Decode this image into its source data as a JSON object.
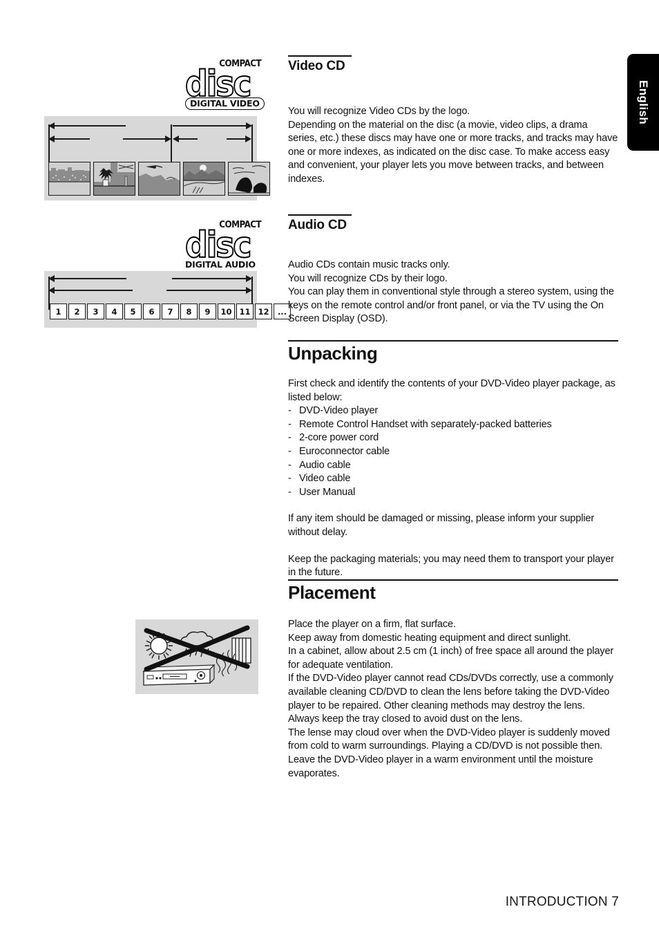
{
  "language_tab": {
    "label": "English"
  },
  "logos": {
    "video": {
      "word": "COMPACT",
      "disc": "disc",
      "sub": "DIGITAL VIDEO"
    },
    "audio": {
      "word": "COMPACT",
      "disc": "disc",
      "sub": "DIGITAL AUDIO"
    }
  },
  "diagrams": {
    "video_cd": {
      "caption": "",
      "thumbnail_count": 5,
      "thumbnails": [
        "city-street-scene",
        "indoor-plant-room-scene",
        "aircraft-over-landscape-scene",
        "sunset-hills-scene",
        "forest-trees-scene"
      ]
    },
    "audio_cd": {
      "tracks": [
        "1",
        "2",
        "3",
        "4",
        "5",
        "6",
        "7",
        "8",
        "9",
        "10",
        "11",
        "12",
        "..."
      ]
    }
  },
  "sections": {
    "video_cd": {
      "heading": "Video CD",
      "body": "You will recognize Video CDs by the logo.\nDepending on the material on the disc (a movie, video clips, a drama series, etc.) these discs may have one or more tracks, and tracks may have one or more indexes, as indicated on the disc case. To make access easy and convenient, your player lets you move between tracks, and between indexes."
    },
    "audio_cd": {
      "heading": "Audio CD",
      "body": "Audio CDs contain music tracks only.\nYou will recognize CDs by their logo.\nYou can play them in conventional style through a stereo system, using the keys on the remote control and/or front panel, or via the TV using the On Screen Display (OSD)."
    },
    "unpacking": {
      "heading": "Unpacking",
      "intro": "First check and identify the contents of your DVD-Video player package, as listed below:",
      "items": [
        "DVD-Video player",
        "Remote Control Handset with separately-packed batteries",
        "2-core power cord",
        "Euroconnector cable",
        "Audio cable",
        "Video cable",
        "User Manual"
      ],
      "para_damaged": "If any item should be damaged or missing, please inform your supplier without delay.",
      "para_packaging": "Keep the packaging materials; you may need them to transport your player in the future."
    },
    "placement": {
      "heading": "Placement",
      "body": "Place the player on a firm, flat surface.\nKeep away from domestic heating equipment and direct sunlight.\nIn a cabinet, allow about 2.5 cm (1 inch) of free space all around the player for adequate ventilation.\nIf the DVD-Video player cannot read CDs/DVDs correctly, use a commonly available cleaning CD/DVD to clean the lens before taking the DVD-Video player to be repaired. Other cleaning methods may destroy the lens. Always keep the tray closed to avoid dust on the lens.\nThe lense may cloud over when the DVD-Video player is suddenly moved from cold to warm surroundings. Playing a CD/DVD is not possible then. Leave the DVD-Video player in a warm environment until the moisture evaporates."
    }
  },
  "footer": {
    "text": "INTRODUCTION 7"
  },
  "colors": {
    "panel_grey": "#d8d8d8",
    "ink": "#111111",
    "tab_bg": "#000000"
  }
}
